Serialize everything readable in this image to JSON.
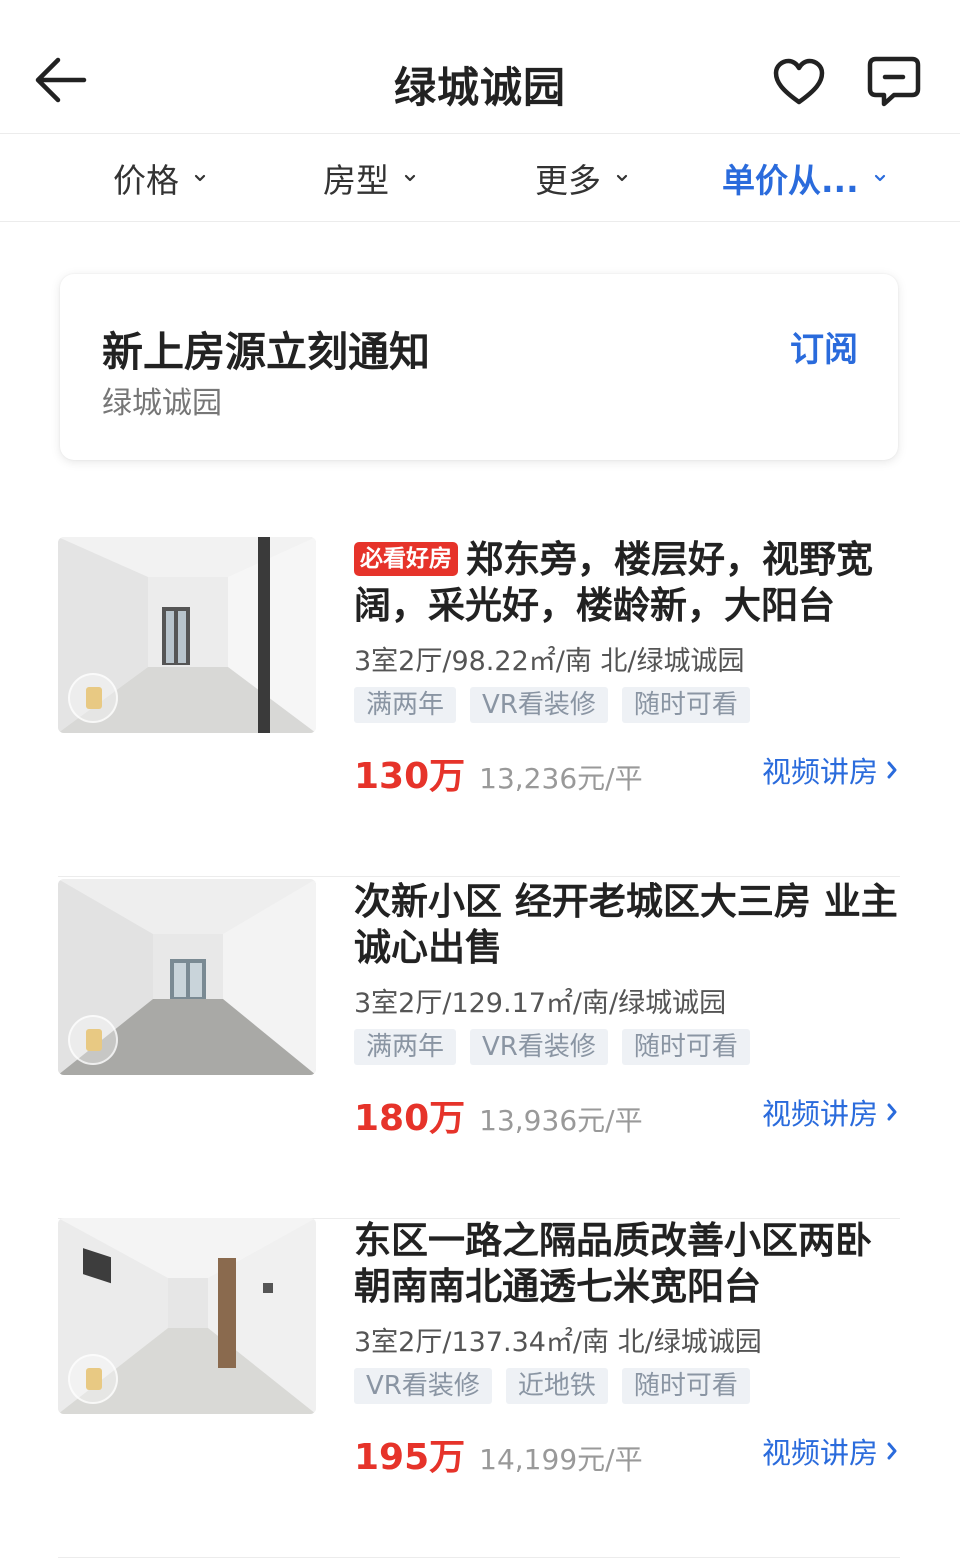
{
  "header": {
    "title": "绿城诚园"
  },
  "filters": [
    {
      "label": "价格",
      "active": false
    },
    {
      "label": "房型",
      "active": false
    },
    {
      "label": "更多",
      "active": false
    },
    {
      "label": "单价从...",
      "active": true
    }
  ],
  "subscribe": {
    "title": "新上房源立刻通知",
    "subtitle": "绿城诚园",
    "button_label": "订阅"
  },
  "listings": [
    {
      "badge": "必看好房",
      "title": "郑东旁，楼层好，视野宽阔，采光好，楼龄新，大阳台",
      "info": "3室2厅/98.22㎡/南 北/绿城诚园",
      "tags": [
        "满两年",
        "VR看装修",
        "随时可看"
      ],
      "price": "130万",
      "unit_price": "13,236元/平",
      "video_label": "视频讲房"
    },
    {
      "badge": "",
      "title": "次新小区 经开老城区大三房 业主诚心出售",
      "info": "3室2厅/129.17㎡/南/绿城诚园",
      "tags": [
        "满两年",
        "VR看装修",
        "随时可看"
      ],
      "price": "180万",
      "unit_price": "13,936元/平",
      "video_label": "视频讲房"
    },
    {
      "badge": "",
      "title": "东区一路之隔品质改善小区两卧朝南南北通透七米宽阳台",
      "info": "3室2厅/137.34㎡/南 北/绿城诚园",
      "tags": [
        "VR看装修",
        "近地铁",
        "随时可看"
      ],
      "price": "195万",
      "unit_price": "14,199元/平",
      "video_label": "视频讲房"
    }
  ],
  "colors": {
    "accent": "#2a6bdc",
    "price": "#e6332a",
    "badge": "#e6332a"
  },
  "icons": [
    "back-arrow-icon",
    "heart-icon",
    "chat-icon",
    "chevron-down-icon",
    "chevron-right-icon",
    "vr-icon"
  ]
}
